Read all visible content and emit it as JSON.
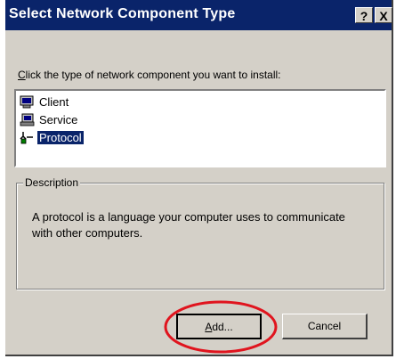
{
  "window": {
    "title": "Select Network Component Type",
    "help_glyph": "?",
    "close_glyph": "X"
  },
  "prompt": {
    "accel_letter": "C",
    "text_rest": "lick the type of network component you want to install:"
  },
  "components": [
    {
      "label": "Client",
      "icon": "client-icon",
      "selected": false
    },
    {
      "label": "Service",
      "icon": "service-icon",
      "selected": false
    },
    {
      "label": "Protocol",
      "icon": "protocol-icon",
      "selected": true
    }
  ],
  "description": {
    "title": "Description",
    "text": "A protocol is a language your computer uses to communicate with other computers."
  },
  "buttons": {
    "add_accel": "A",
    "add_rest": "dd...",
    "cancel": "Cancel"
  },
  "colors": {
    "titlebar": "#0a246a",
    "dialog_face": "#d4d0c8",
    "selection": "#0a246a",
    "annotation": "#e0141e"
  }
}
